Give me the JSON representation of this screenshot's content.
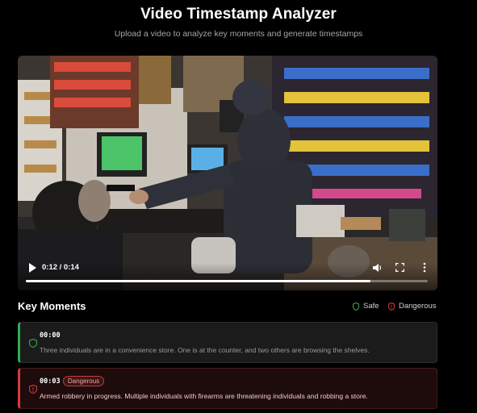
{
  "header": {
    "title": "Video Timestamp Analyzer",
    "subtitle": "Upload a video to analyze key moments and generate timestamps"
  },
  "video": {
    "time_display": "0:12 / 0:14",
    "progress_fraction": 0.857
  },
  "key_moments": {
    "heading": "Key Moments",
    "legend_safe": "Safe",
    "legend_dangerous": "Dangerous",
    "items": [
      {
        "timestamp": "00:00",
        "status": "safe",
        "badge": "",
        "description": "Three individuals are in a convenience store. One is at the counter, and two others are browsing the shelves."
      },
      {
        "timestamp": "00:03",
        "status": "dangerous",
        "badge": "Dangerous",
        "description": "Armed robbery in progress. Multiple individuals with firearms are threatening individuals and robbing a store."
      }
    ]
  },
  "colors": {
    "safe": "#2fae4c",
    "dangerous": "#d63b3b"
  }
}
